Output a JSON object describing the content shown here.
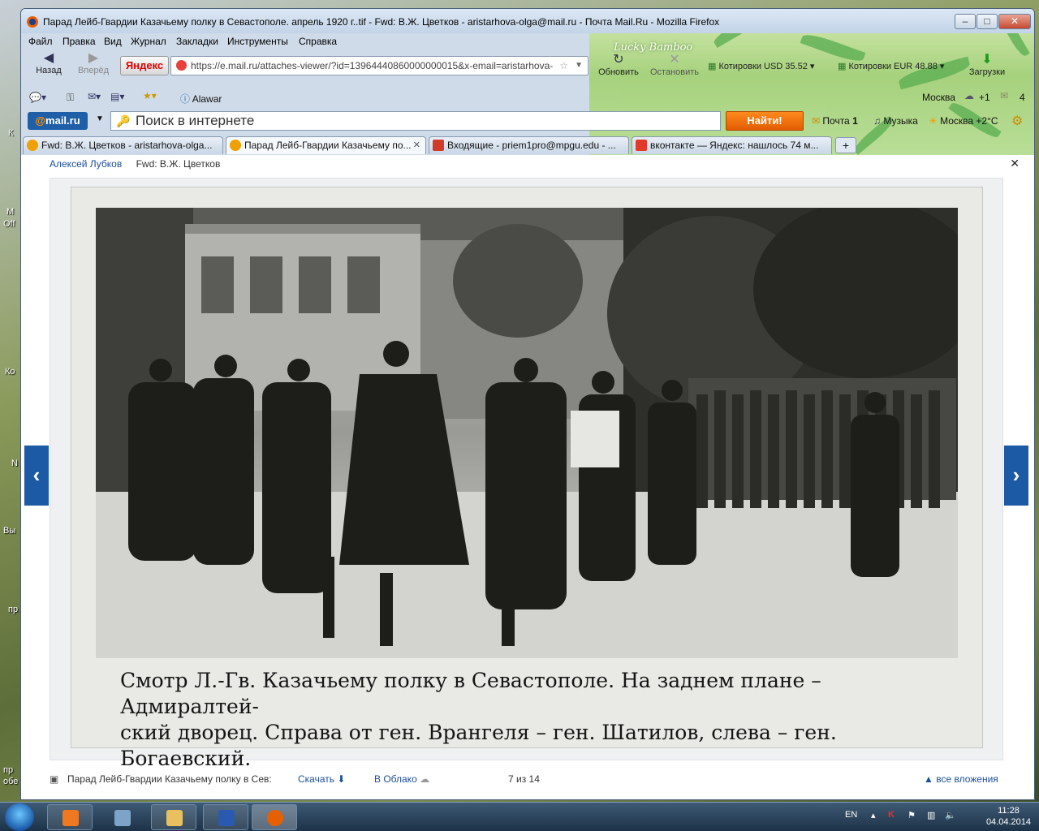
{
  "window": {
    "title": "Парад Лейб-Гвардии Казачьему полку в Севастополе. апрель 1920 г..tif - Fwd: В.Ж. Цветков - aristarhova-olga@mail.ru - Почта Mail.Ru - Mozilla Firefox",
    "minimize": "–",
    "maximize": "□",
    "close": "✕"
  },
  "theme": {
    "title": "Lucky Bamboo"
  },
  "menu": [
    "Файл",
    "Правка",
    "Вид",
    "Журнал",
    "Закладки",
    "Инструменты",
    "Справка"
  ],
  "nav": {
    "back": "Назад",
    "forward": "Вперёд",
    "yandex": "Яндекс",
    "url": "https://e.mail.ru/attaches-viewer/?id=13964440860000000015&x-email=aristarhova-",
    "reload": "Обновить",
    "stop": "Остановить",
    "usd": "Котировки USD 35.52",
    "eur": "Котировки EUR 48.88",
    "downloads": "Загрузки"
  },
  "toolbar2": {
    "alawar": "Alawar",
    "city": "Москва",
    "temp_small": "+1",
    "count": "4"
  },
  "searchbar": {
    "logo_at": "@",
    "logo_text": "mail.ru",
    "placeholder": "Поиск в интернете",
    "find": "Найти!",
    "mail": "Почта",
    "mail_count": "1",
    "music": "Музыка",
    "weather": "Москва +2°C"
  },
  "tabs": [
    {
      "label": "Fwd: В.Ж. Цветков - aristarhova-olga...",
      "active": false
    },
    {
      "label": "Парад Лейб-Гвардии Казачьему по...",
      "active": true
    },
    {
      "label": "Входящие - priem1pro@mpgu.edu - ...",
      "active": false
    },
    {
      "label": "вконтакте — Яндекс: нашлось 74 м...",
      "active": false
    }
  ],
  "viewer": {
    "sender": "Алексей Лубков",
    "subject": "Fwd: В.Ж. Цветков",
    "caption_line1": "Смотр   Л.-Гв. Казачьему полку в Севастополе. На заднем плане – Адмиралтей-",
    "caption_line2": "ский дворец.   Справа от ген. Врангеля – ген. Шатилов, слева – ген. Богаевский.",
    "filename": "Парад Лейб-Гвардии Казачьему полку в Сев:",
    "download": "Скачать",
    "cloud": "В Облако",
    "counter": "7 из 14",
    "all_attachments": "все вложения"
  },
  "desktop": {
    "labels": [
      "К",
      "M",
      "Off",
      "Ко",
      "N",
      "Вы",
      "пр",
      "пр",
      "обе"
    ]
  },
  "taskbar": {
    "lang": "EN",
    "time": "11:28",
    "date": "04.04.2014"
  }
}
